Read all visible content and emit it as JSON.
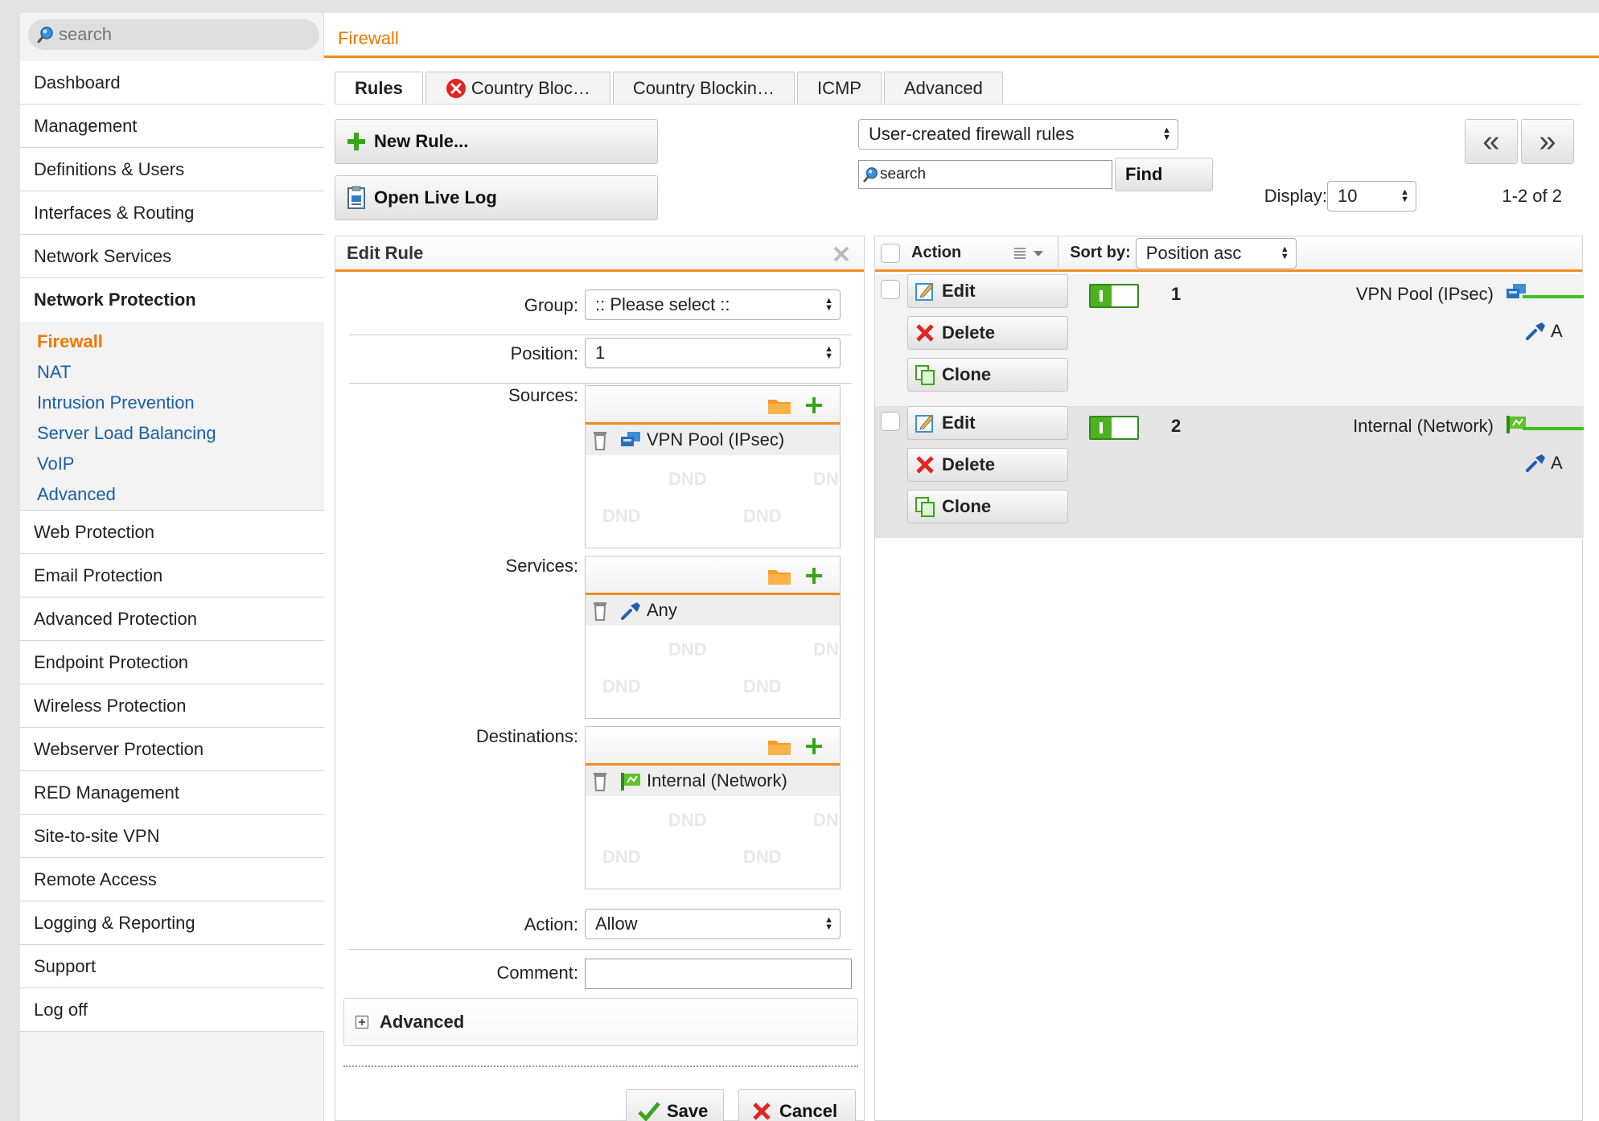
{
  "sidebar": {
    "search_placeholder": "search",
    "items": [
      "Dashboard",
      "Management",
      "Definitions & Users",
      "Interfaces & Routing",
      "Network Services",
      "Network Protection",
      "Web Protection",
      "Email Protection",
      "Advanced Protection",
      "Endpoint Protection",
      "Wireless Protection",
      "Webserver Protection",
      "RED Management",
      "Site-to-site VPN",
      "Remote Access",
      "Logging & Reporting",
      "Support",
      "Log off"
    ],
    "subitems": [
      "Firewall",
      "NAT",
      "Intrusion Prevention",
      "Server Load Balancing",
      "VoIP",
      "Advanced"
    ]
  },
  "header": {
    "title": "Firewall"
  },
  "tabs": [
    "Rules",
    "Country Bloc…",
    "Country Blockin…",
    "ICMP",
    "Advanced"
  ],
  "toolbar": {
    "new_rule": "New Rule...",
    "open_live_log": "Open Live Log",
    "filter_select": "User-created firewall rules",
    "search_value": "search",
    "find": "Find",
    "display_label": "Display:",
    "display_value": "10",
    "paging": "1-2 of 2",
    "prev": "«",
    "next": "»"
  },
  "edit_rule": {
    "title": "Edit Rule",
    "group_label": "Group:",
    "group_value": ":: Please select ::",
    "position_label": "Position:",
    "position_value": "1",
    "sources_label": "Sources:",
    "sources_item": "VPN Pool (IPsec)",
    "services_label": "Services:",
    "services_item": "Any",
    "destinations_label": "Destinations:",
    "destinations_item": "Internal (Network)",
    "dnd": "DND",
    "action_label": "Action:",
    "action_value": "Allow",
    "comment_label": "Comment:",
    "comment_value": "",
    "advanced": "Advanced",
    "save": "Save",
    "cancel": "Cancel"
  },
  "grid": {
    "action_header": "Action",
    "sortby_label": "Sort by:",
    "sortby_value": "Position asc",
    "edit": "Edit",
    "delete": "Delete",
    "clone": "Clone",
    "rows": [
      {
        "position": "1",
        "source": "VPN Pool (IPsec)",
        "service_short": "A"
      },
      {
        "position": "2",
        "source": "Internal (Network)",
        "service_short": "A"
      }
    ]
  },
  "colors": {
    "accent": "#f07800",
    "link": "#1a5ea8",
    "toggle_on": "#4cb31f"
  }
}
